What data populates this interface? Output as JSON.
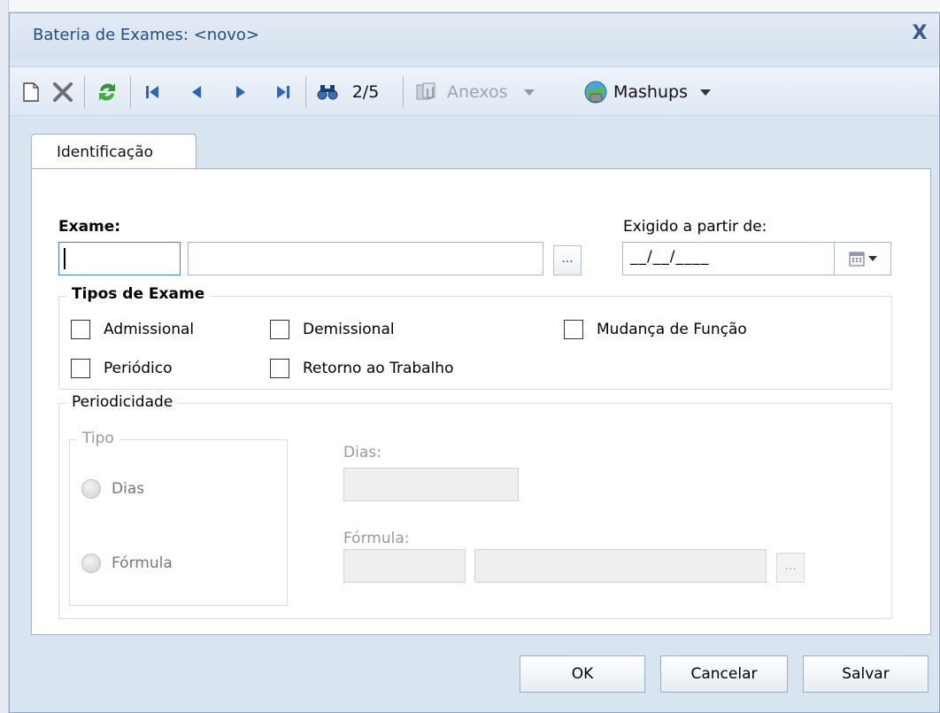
{
  "window": {
    "title": "Bateria de Exames: <novo>",
    "close_glyph": "X"
  },
  "toolbar": {
    "new_icon": "new-document-icon",
    "delete_icon": "delete-icon",
    "refresh_icon": "refresh-icon",
    "first_icon": "first-record-icon",
    "prev_icon": "previous-record-icon",
    "next_icon": "next-record-icon",
    "last_icon": "last-record-icon",
    "find_icon": "binoculars-icon",
    "record_position": "2/5",
    "attachments_label": "Anexos",
    "mashups_label": "Mashups"
  },
  "tabs": [
    {
      "label": "Identificação",
      "active": true
    }
  ],
  "form": {
    "exame_label": "Exame:",
    "exigido_label": "Exigido a partir de:",
    "date_mask": "__/__/____",
    "ellipsis": "...",
    "tipos_legend": "Tipos de Exame",
    "tipos": [
      {
        "label": "Admissional",
        "checked": false
      },
      {
        "label": "Demissional",
        "checked": false
      },
      {
        "label": "Mudança de Função",
        "checked": false
      },
      {
        "label": "Periódico",
        "checked": false
      },
      {
        "label": "Retorno ao Trabalho",
        "checked": false
      }
    ],
    "periodicidade_legend": "Periodicidade",
    "tipo_legend": "Tipo",
    "radio_dias": "Dias",
    "radio_formula": "Fórmula",
    "dias_label": "Dias:",
    "formula_label": "Fórmula:"
  },
  "footer": {
    "ok": "OK",
    "cancel": "Cancelar",
    "save": "Salvar"
  },
  "colors": {
    "title_text": "#244d85",
    "window_frame": "#8ea6c6",
    "toolbar_bg": "#dfe8f4",
    "disabled_text": "#9a9a9a"
  }
}
